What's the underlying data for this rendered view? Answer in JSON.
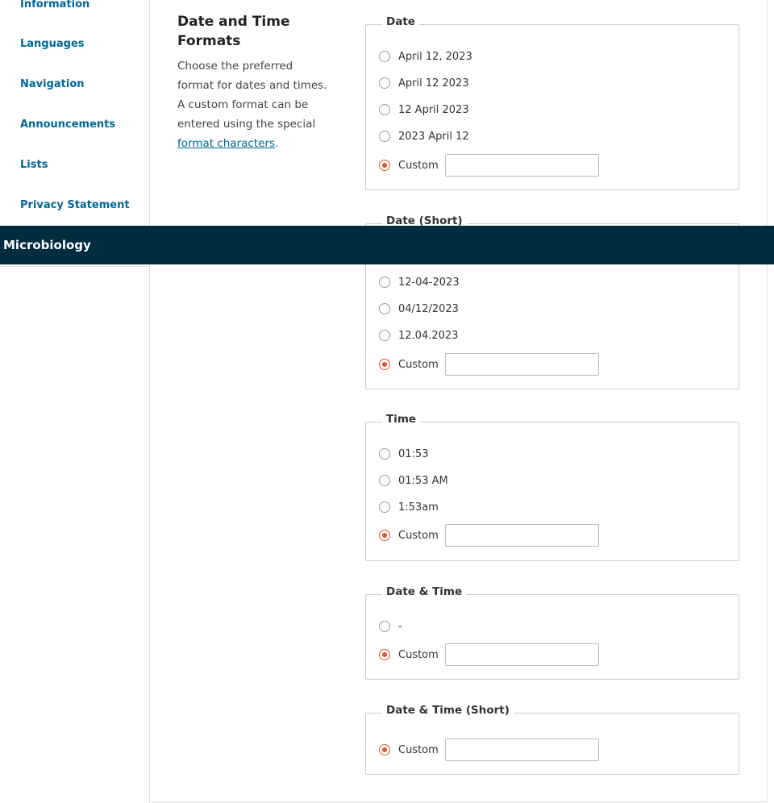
{
  "sidebar": {
    "items": [
      {
        "label": "Information"
      },
      {
        "label": "Languages"
      },
      {
        "label": "Navigation"
      },
      {
        "label": "Announcements"
      },
      {
        "label": "Lists"
      },
      {
        "label": "Privacy Statement"
      }
    ]
  },
  "header_bar": {
    "title": "Microbiology"
  },
  "section": {
    "title": "Date and Time Formats",
    "description_pre": "Choose the preferred format for dates and times. A custom format can be entered using the special ",
    "description_link": "format characters",
    "description_post": "."
  },
  "fieldsets": {
    "date": {
      "legend": "Date",
      "options": [
        "April 12, 2023",
        "April 12 2023",
        "12 April 2023",
        "2023 April 12"
      ],
      "custom_label": "Custom",
      "custom_value": ""
    },
    "date_short": {
      "legend": "Date (Short)",
      "options": [
        "12-04-2023",
        "04/12/2023",
        "12.04.2023"
      ],
      "custom_label": "Custom",
      "custom_value": ""
    },
    "time": {
      "legend": "Time",
      "options": [
        "01:53",
        "01:53 AM",
        "1:53am"
      ],
      "custom_label": "Custom",
      "custom_value": ""
    },
    "date_time": {
      "legend": "Date & Time",
      "options": [
        "-"
      ],
      "custom_label": "Custom",
      "custom_value": ""
    },
    "date_time_short": {
      "legend": "Date & Time (Short)",
      "custom_label": "Custom",
      "custom_value": ""
    }
  },
  "colors": {
    "accent": "#e0552e",
    "link": "#006798",
    "header_bg": "#002c40"
  }
}
